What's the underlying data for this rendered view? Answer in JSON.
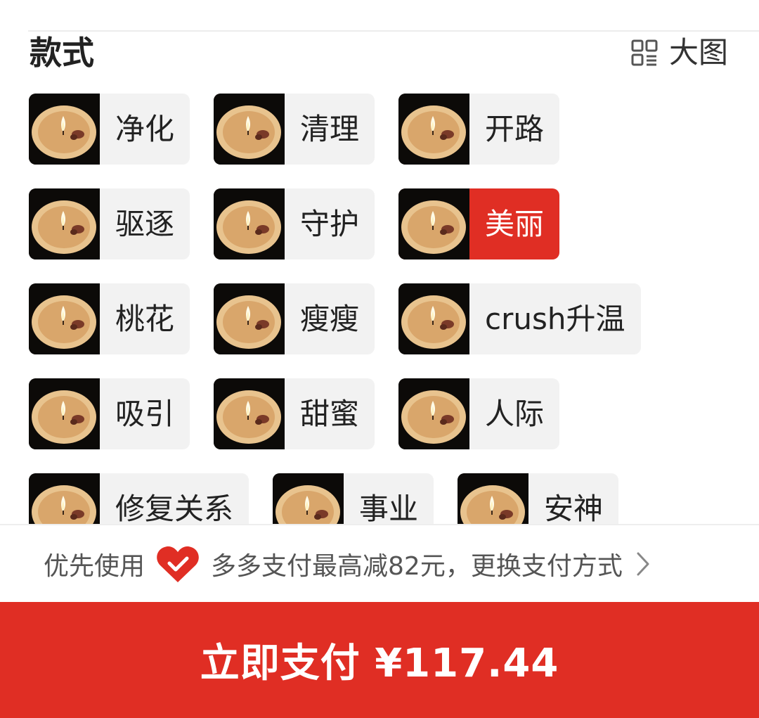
{
  "section": {
    "title": "款式",
    "view_toggle_label": "大图"
  },
  "options": [
    {
      "label": "净化",
      "selected": false
    },
    {
      "label": "清理",
      "selected": false
    },
    {
      "label": "开路",
      "selected": false
    },
    {
      "label": "驱逐",
      "selected": false
    },
    {
      "label": "守护",
      "selected": false
    },
    {
      "label": "美丽",
      "selected": true
    },
    {
      "label": "桃花",
      "selected": false
    },
    {
      "label": "瘦瘦",
      "selected": false
    },
    {
      "label": "crush升温",
      "selected": false
    },
    {
      "label": "吸引",
      "selected": false
    },
    {
      "label": "甜蜜",
      "selected": false
    },
    {
      "label": "人际",
      "selected": false
    },
    {
      "label": "修复关系",
      "selected": false
    },
    {
      "label": "事业",
      "selected": false
    },
    {
      "label": "安神",
      "selected": false
    }
  ],
  "payment_notice": {
    "prefix": "优先使用",
    "message": "多多支付最高减82元，更换支付方式",
    "icon": "heart-check-icon"
  },
  "pay_button": {
    "label": "立即支付 ¥117.44"
  },
  "colors": {
    "accent": "#e02e24",
    "chip_bg": "#f2f2f2"
  }
}
